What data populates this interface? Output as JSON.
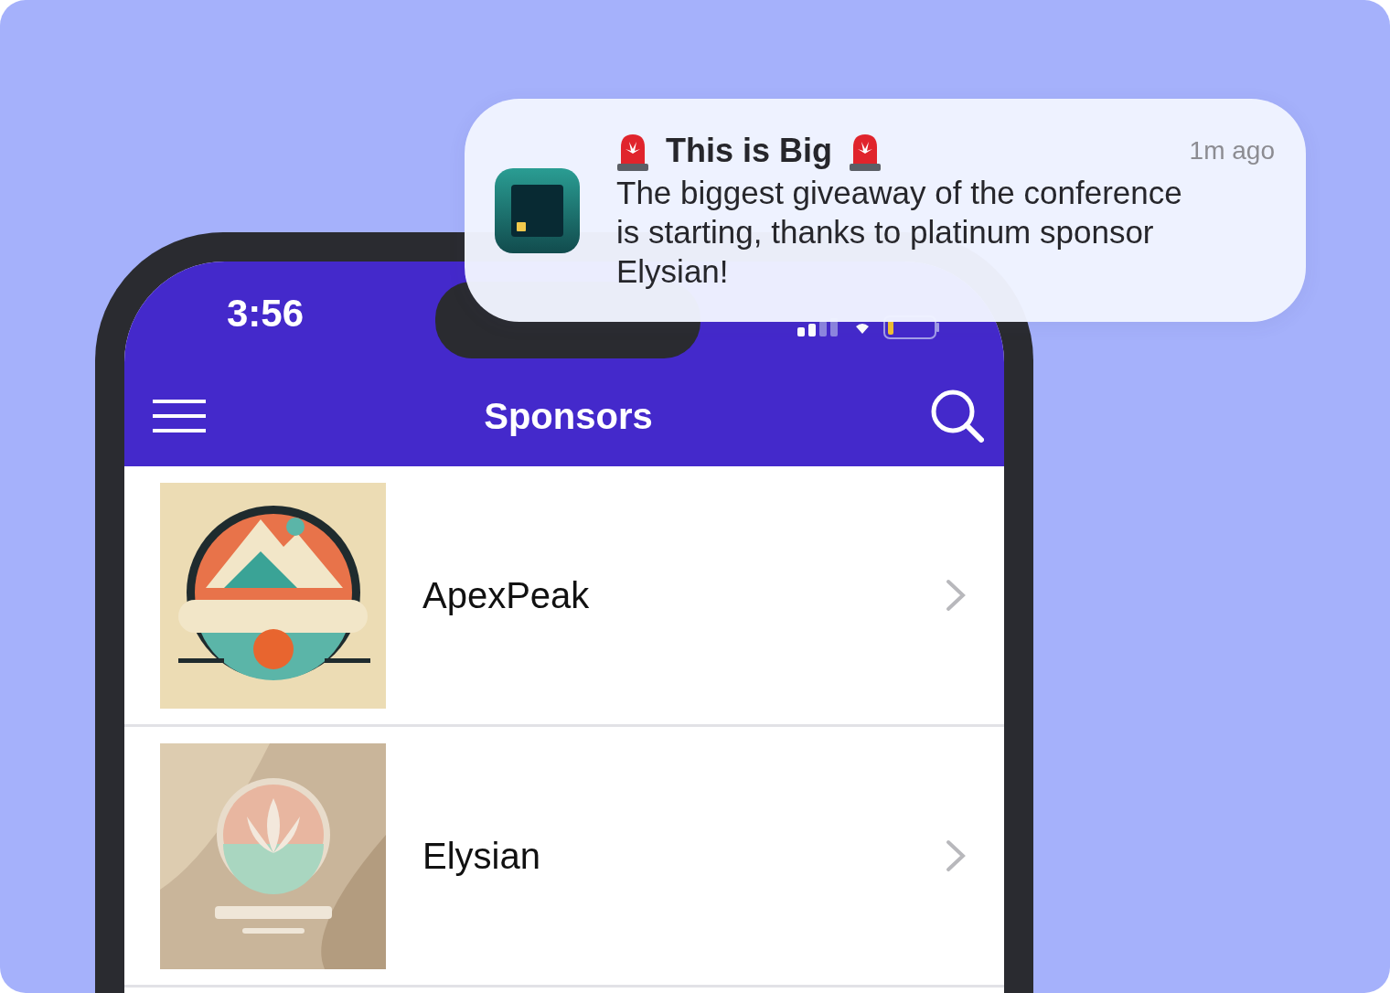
{
  "status_bar": {
    "time": "3:56"
  },
  "nav_bar": {
    "title": "Sponsors"
  },
  "sponsors": [
    {
      "name": "ApexPeak"
    },
    {
      "name": "Elysian"
    }
  ],
  "notification": {
    "title": "This is Big",
    "time": "1m ago",
    "body": "The biggest giveaway of the conference is starting, thanks to platinum sponsor Elysian!"
  }
}
